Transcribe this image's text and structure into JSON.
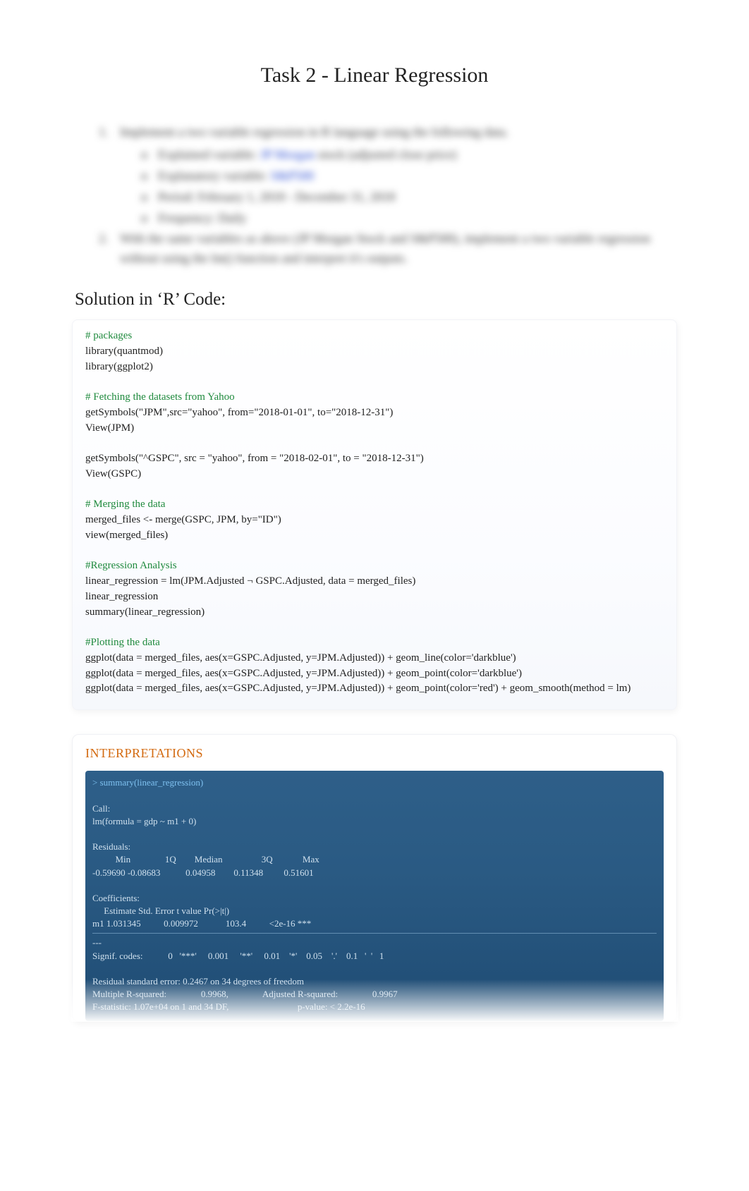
{
  "title": "Task 2 - Linear Regression",
  "question": {
    "items": [
      {
        "num": "1.",
        "text": "Implement a two variable regression in R language using the following data.",
        "subs": [
          {
            "mark": "o",
            "text_pre": "Explained variable: ",
            "link": "JP Morgan",
            "text_post": " stock (adjusted close price)"
          },
          {
            "mark": "o",
            "text_pre": "Explanatory variable: ",
            "link": "S&P500",
            "text_post": ""
          },
          {
            "mark": "o",
            "text_pre": "Period: February 1, 2018 - December 31, 2018",
            "link": "",
            "text_post": ""
          },
          {
            "mark": "o",
            "text_pre": "Frequency: Daily",
            "link": "",
            "text_post": ""
          }
        ]
      },
      {
        "num": "2.",
        "text": "With the same variables as above (JP Morgan Stock and S&P500), implement a two variable regression without using the lm() function and interpret it's outputs."
      }
    ]
  },
  "solution_heading": "Solution in ‘R’ Code:",
  "code": {
    "lines": [
      {
        "t": "# packages",
        "c": true
      },
      {
        "t": "library(quantmod)"
      },
      {
        "t": "library(ggplot2)"
      },
      {
        "t": ""
      },
      {
        "t": "# Fetching the datasets from Yahoo",
        "c": true
      },
      {
        "t": "getSymbols(\"JPM\",src=\"yahoo\", from=\"2018-01-01\", to=\"2018-12-31\")"
      },
      {
        "t": "View(JPM)"
      },
      {
        "t": ""
      },
      {
        "t": "getSymbols(\"^GSPC\", src = \"yahoo\", from = \"2018-02-01\", to = \"2018-12-31\")"
      },
      {
        "t": "View(GSPC)"
      },
      {
        "t": ""
      },
      {
        "t": "# Merging the data",
        "c": true
      },
      {
        "t": "merged_files <- merge(GSPC, JPM, by=\"ID\")"
      },
      {
        "t": "view(merged_files)"
      },
      {
        "t": ""
      },
      {
        "t": "#Regression Analysis",
        "c": true
      },
      {
        "t": "linear_regression = lm(JPM.Adjusted ¬ GSPC.Adjusted, data = merged_files)"
      },
      {
        "t": "linear_regression"
      },
      {
        "t": "summary(linear_regression)"
      },
      {
        "t": ""
      },
      {
        "t": "#Plotting the data",
        "c": true
      },
      {
        "t": "ggplot(data = merged_files, aes(x=GSPC.Adjusted, y=JPM.Adjusted)) + geom_line(color='darkblue')"
      },
      {
        "t": "ggplot(data = merged_files, aes(x=GSPC.Adjusted, y=JPM.Adjusted)) + geom_point(color='darkblue')"
      },
      {
        "t": "ggplot(data = merged_files, aes(x=GSPC.Adjusted, y=JPM.Adjusted)) + geom_point(color='red') + geom_smooth(method = lm)"
      }
    ]
  },
  "interp": {
    "heading": "INTERPRETATIONS",
    "console": [
      {
        "t": "> summary(linear_regression)",
        "cls": "sum"
      },
      {
        "t": ""
      },
      {
        "t": "Call:"
      },
      {
        "t": "lm(formula = gdp ~ m1 + 0)"
      },
      {
        "t": ""
      },
      {
        "t": "Residuals:"
      },
      {
        "t": "          Min               1Q        Median                 3Q             Max"
      },
      {
        "t": "-0.59690 -0.08683           0.04958        0.11348         0.51601"
      },
      {
        "t": ""
      },
      {
        "t": "Coefficients:"
      },
      {
        "t": "     Estimate Std. Error t value Pr(>|t|)"
      },
      {
        "t": "m1 1.031345          0.009972            103.4          <2e-16 ***"
      },
      {
        "t": "---",
        "hr": true
      },
      {
        "t": "Signif. codes:           0   '***'     0.001     '**'     0.01    '*'    0.05    '.'    0.1   '  '   1"
      },
      {
        "t": ""
      },
      {
        "t": "Residual standard error: 0.2467 on 34 degrees of freedom"
      },
      {
        "t": "Multiple R-squared:               0.9968,               Adjusted R-squared:               0.9967"
      },
      {
        "t": "F-statistic: 1.07e+04 on 1 and 34 DF,                              p-value: < 2.2e-16"
      }
    ]
  }
}
